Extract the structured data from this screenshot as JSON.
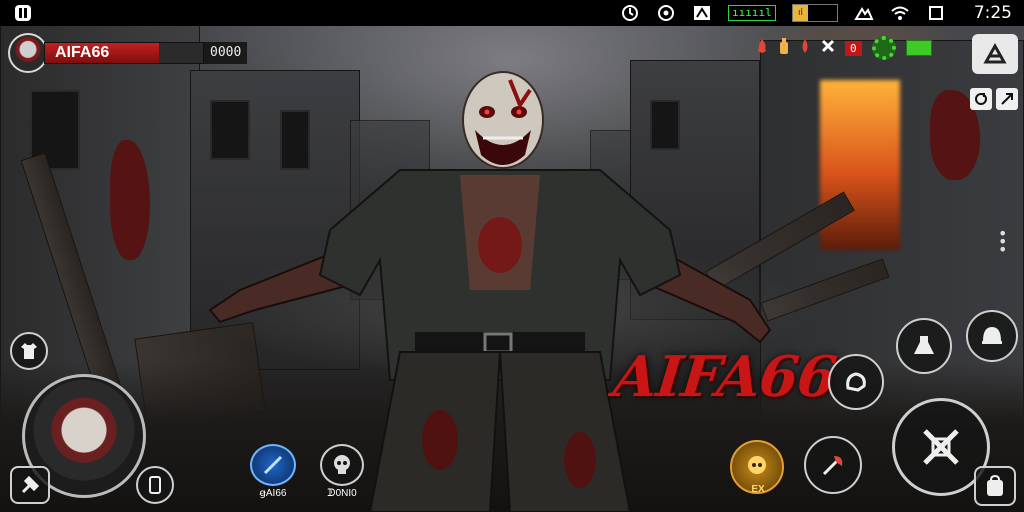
{
  "status_bar": {
    "left_icon": "app-icon",
    "icons": [
      "alarm-icon",
      "settings-wheel-icon",
      "network-icon"
    ],
    "network_text": "ıııııl",
    "battery_level": 0.35,
    "battery_text": "ıl",
    "right_icons": [
      "signal-icon",
      "wifi-icon",
      "screen-rotate-icon"
    ],
    "time": "7:25"
  },
  "player": {
    "name": "AIFA66",
    "score": "0000",
    "health": 0.72
  },
  "top_right": {
    "icons": [
      "fire-icon",
      "bottle-icon",
      "blood-drop-icon",
      "crossed-bones-icon"
    ],
    "count": "0",
    "gear_color": "#4cd33a",
    "green_bar": "#3ecb2a",
    "corner_button_icon": "map-tool-icon",
    "small_buttons": [
      "refresh-icon",
      "share-icon"
    ]
  },
  "controls": {
    "joystick_icon": "zombie-portrait",
    "left_button_icon": "shirt-icon",
    "bottom_left_icon": "hammer-icon",
    "bottom_left_small_icon": "phone-icon",
    "skill_1_label": "ꞡAI66",
    "skill_2_label": "ᗫ0NI0",
    "center_logo": "AIFA66",
    "coin_label": "EX",
    "attack_button_icon": "crossed-swords-icon",
    "right_small_buttons": [
      "glove-icon",
      "helmet-icon",
      "axe-icon"
    ],
    "bottom_right_icon": "backpack-icon"
  },
  "colors": {
    "accent_red": "#c81616",
    "health_red": "#c42020",
    "battery_yellow": "#e8b63a",
    "net_green": "#3cff55"
  }
}
